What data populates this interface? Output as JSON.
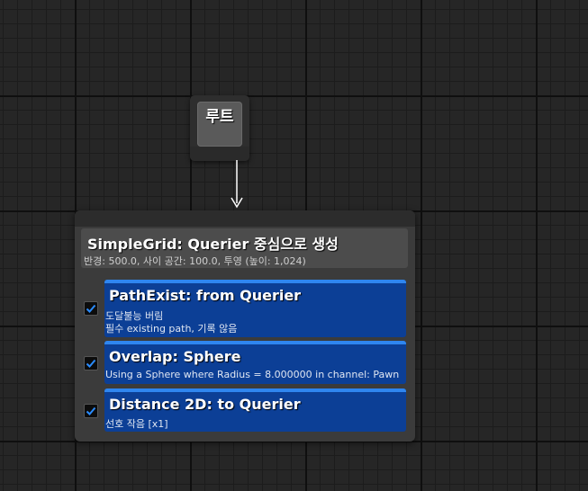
{
  "root": {
    "label": "루트"
  },
  "composite": {
    "title": "SimpleGrid: Querier 중심으로 생성",
    "subtitle": "반경: 500.0, 사이 공간: 100.0, 투영 (높이: 1,024)"
  },
  "tests": [
    {
      "title": "PathExist: from Querier",
      "lines": [
        "도달불능 버림",
        "필수 existing path, 기록 않음"
      ],
      "enabled": true
    },
    {
      "title": "Overlap: Sphere",
      "lines": [
        "Using a Sphere where Radius = 8.000000 in channel: Pawn"
      ],
      "enabled": true
    },
    {
      "title": "Distance 2D: to Querier",
      "lines": [
        "선호 작음 [x1]"
      ],
      "enabled": true
    }
  ],
  "colors": {
    "test_blue": "#0c3f96",
    "test_stripe": "#2f86f0",
    "check_blue": "#2a8cff"
  },
  "icons": {
    "checkbox": "check-mark-icon",
    "connector": "arrow-down-icon"
  }
}
